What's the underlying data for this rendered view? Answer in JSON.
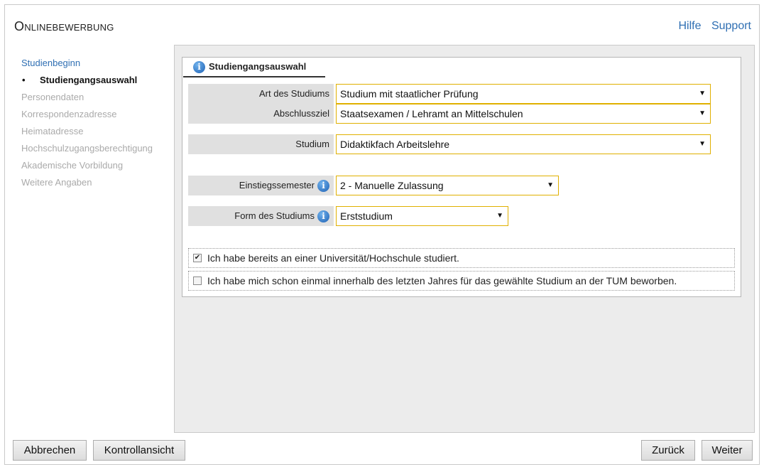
{
  "header": {
    "title": "Onlinebewerbung",
    "links": [
      "Hilfe",
      "Support"
    ]
  },
  "nav": {
    "items": [
      {
        "label": "Studienbeginn",
        "state": "done"
      },
      {
        "label": "Studiengangsauswahl",
        "state": "active"
      },
      {
        "label": "Personendaten",
        "state": "disabled"
      },
      {
        "label": "Korrespondenzadresse",
        "state": "disabled"
      },
      {
        "label": "Heimatadresse",
        "state": "disabled"
      },
      {
        "label": "Hochschulzugangsberechtigung",
        "state": "disabled"
      },
      {
        "label": "Akademische Vorbildung",
        "state": "disabled"
      },
      {
        "label": "Weitere Angaben",
        "state": "disabled"
      }
    ],
    "bullet": "•"
  },
  "panel": {
    "tab_label": "Studiengangsauswahl",
    "info_glyph": "i",
    "fields": {
      "art": {
        "label": "Art des Studiums",
        "value": "Studium mit staatlicher Prüfung"
      },
      "abschluss": {
        "label": "Abschlussziel",
        "value": "Staatsexamen / Lehramt an Mittelschulen"
      },
      "studium": {
        "label": "Studium",
        "value": "Didaktikfach Arbeitslehre"
      },
      "semester": {
        "label": "Einstiegssemester",
        "value": "2 - Manuelle Zulassung"
      },
      "form": {
        "label": "Form des Studiums",
        "value": "Erststudium"
      }
    },
    "dropdown_arrow": "▼",
    "checkboxes": [
      {
        "label": "Ich habe bereits an einer Universität/Hochschule studiert.",
        "checked": true,
        "mark": "✔"
      },
      {
        "label": "Ich habe mich schon einmal innerhalb des letzten Jahres für das gewählte Studium an der TUM beworben.",
        "checked": false,
        "mark": ""
      }
    ]
  },
  "footer": {
    "cancel": "Abbrechen",
    "review": "Kontrollansicht",
    "back": "Zurück",
    "next": "Weiter"
  },
  "colors": {
    "link": "#2f6fb3",
    "select_border": "#e0b000",
    "label_bg": "#e0e0e0"
  }
}
